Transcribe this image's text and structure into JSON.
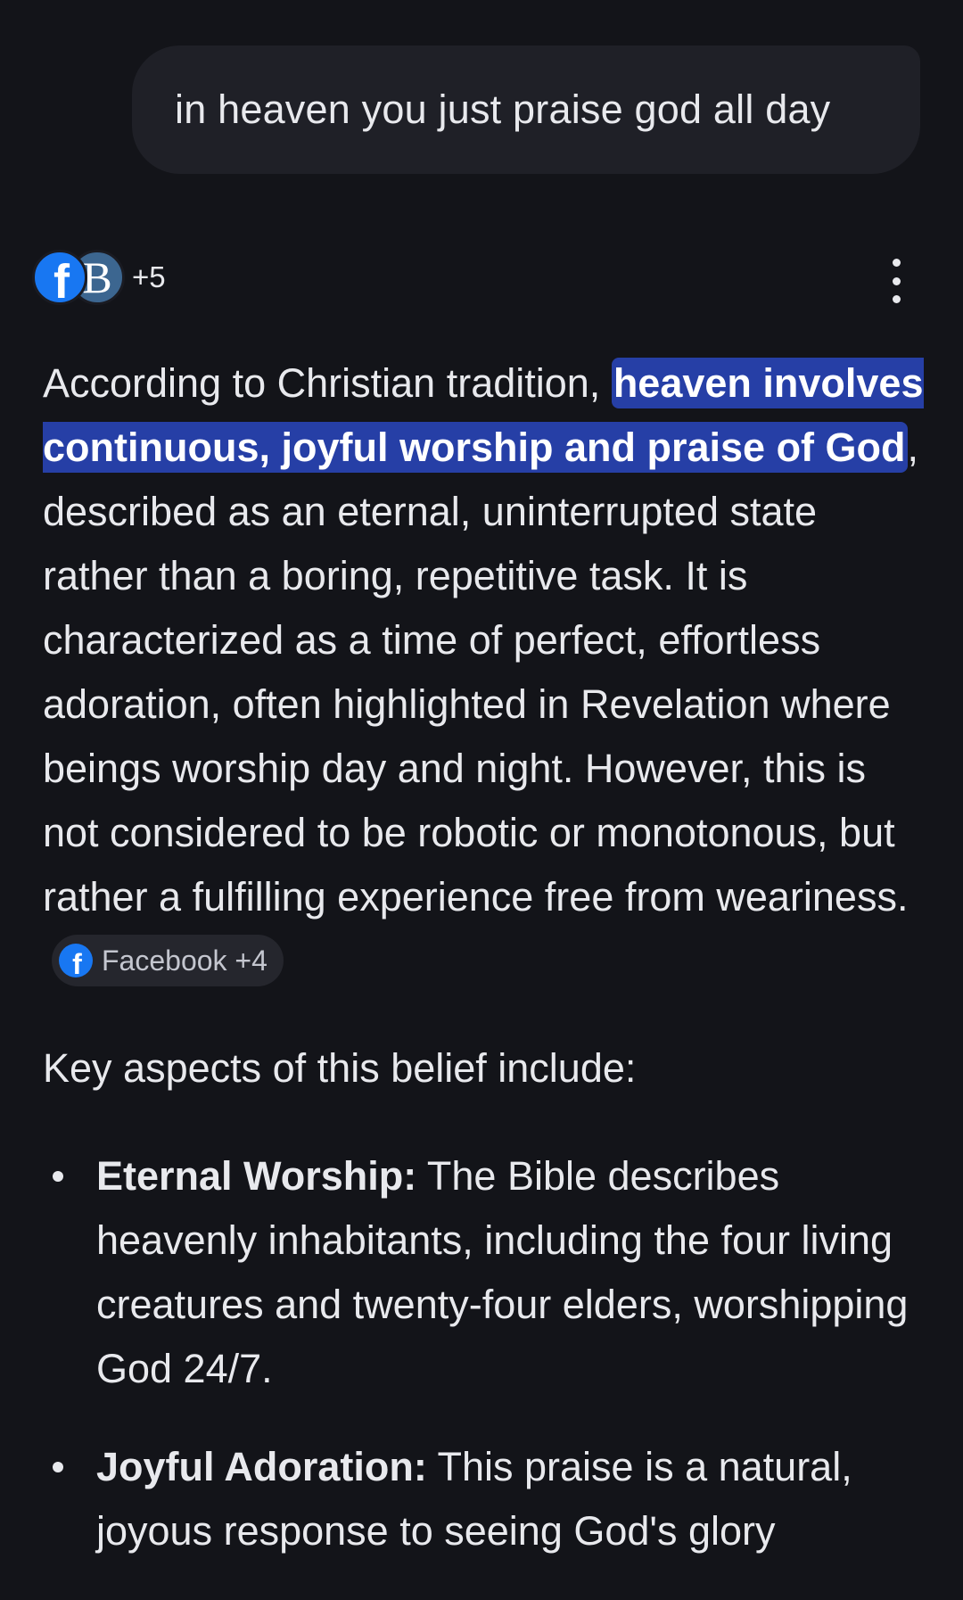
{
  "user_message": {
    "text": "in heaven you just praise god all day"
  },
  "sources": {
    "facebook_glyph": "f",
    "b_glyph": "B",
    "more_count": "+5",
    "icons": [
      "facebook-icon",
      "b-site-icon"
    ]
  },
  "menu": {
    "icon": "more-vert-icon"
  },
  "answer": {
    "intro_prefix": "According to Christian tradition, ",
    "highlight": "heaven involves continuous, joyful worship and praise of God",
    "intro_suffix": ", described as an eternal, uninterrupted state rather than a boring, repetitive task. It is characterized as a time of perfect, effortless adoration, often highlighted in Revelation where beings worship day and night. However, this is not considered to be robotic or monotonous, but rather a fulfilling experience free from weariness.",
    "citation_chip": {
      "glyph": "f",
      "label": "Facebook +4"
    },
    "key_aspects_heading": "Key aspects of this belief include:",
    "bullets": [
      {
        "title": "Eternal Worship:",
        "text": " The Bible describes heavenly inhabitants, including the four living creatures and twenty-four elders, worshipping God 24/7."
      },
      {
        "title": "Joyful Adoration:",
        "text": " This praise is a natural, joyous response to seeing God's glory"
      }
    ]
  },
  "colors": {
    "background": "#131419",
    "bubble": "#1f2027",
    "highlight": "#263fa6",
    "chip": "#25262d",
    "facebook": "#1877f2"
  }
}
